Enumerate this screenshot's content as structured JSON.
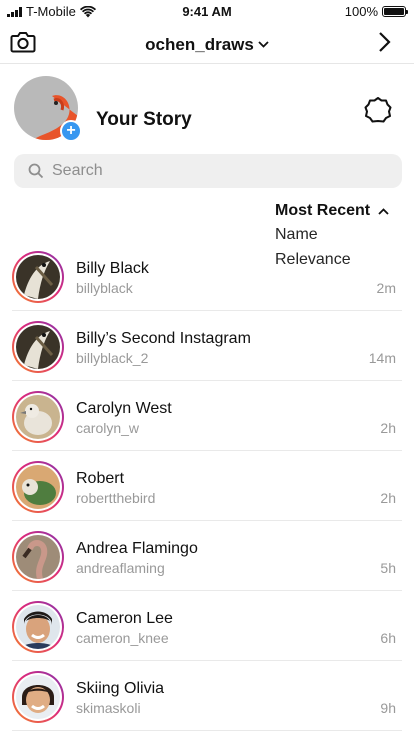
{
  "status_bar": {
    "carrier": "T-Mobile",
    "time": "9:41 AM",
    "battery": "100%",
    "battery_level": 1.0
  },
  "header": {
    "username": "ochen_draws",
    "camera_icon": "camera-icon",
    "next_icon": "chevron-right-icon"
  },
  "story": {
    "label": "Your Story",
    "add_icon": "+",
    "settings_icon": "settings-icon"
  },
  "search": {
    "placeholder": "Search",
    "value": ""
  },
  "sort": {
    "selected": "Most Recent",
    "options": [
      "Name",
      "Relevance"
    ]
  },
  "contacts": [
    {
      "name": "Billy Black",
      "username": "billyblack",
      "time": "2m"
    },
    {
      "name": "Billy’s Second Instagram",
      "username": "billyblack_2",
      "time": "14m"
    },
    {
      "name": "Carolyn West",
      "username": "carolyn_w",
      "time": "2h"
    },
    {
      "name": "Robert",
      "username": "robertthebird",
      "time": "2h"
    },
    {
      "name": "Andrea Flamingo",
      "username": "andreaflaming",
      "time": "5h"
    },
    {
      "name": "Cameron Lee",
      "username": "cameron_knee",
      "time": "6h"
    },
    {
      "name": "Skiing Olivia",
      "username": "skimaskoli",
      "time": "9h"
    }
  ],
  "colors": {
    "accent": "#3897f0",
    "ring_start": "#f58529",
    "ring_mid": "#dd2a7b",
    "ring_end": "#8134af",
    "secondary_text": "#999999"
  }
}
